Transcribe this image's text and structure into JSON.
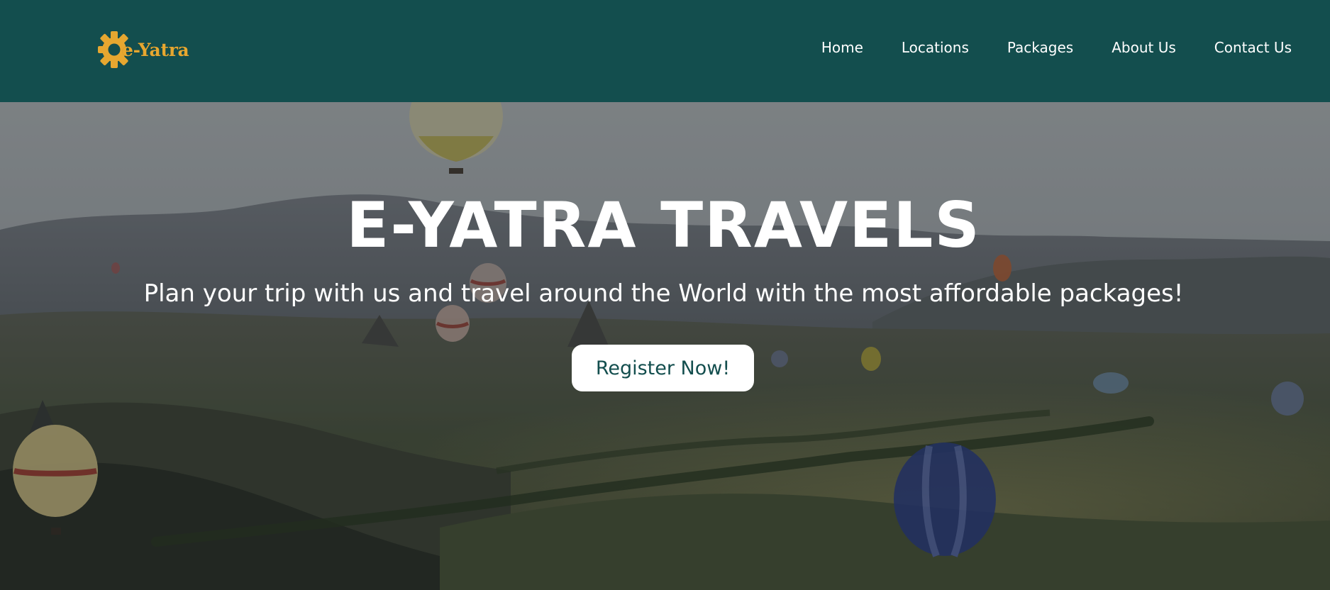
{
  "brand": {
    "logo_text": "e-Yatra",
    "logo_icon": "gear-icon",
    "accent_color": "#e6a730"
  },
  "nav": {
    "background": "#134e4e",
    "links": [
      "Home",
      "Locations",
      "Packages",
      "About Us",
      "Contact Us"
    ]
  },
  "hero": {
    "title": "E-YATRA TRAVELS",
    "subtitle": "Plan your trip with us and travel around the World with the most affordable packages!",
    "cta_label": "Register Now!",
    "background": "hot-air-balloons-over-valley"
  }
}
